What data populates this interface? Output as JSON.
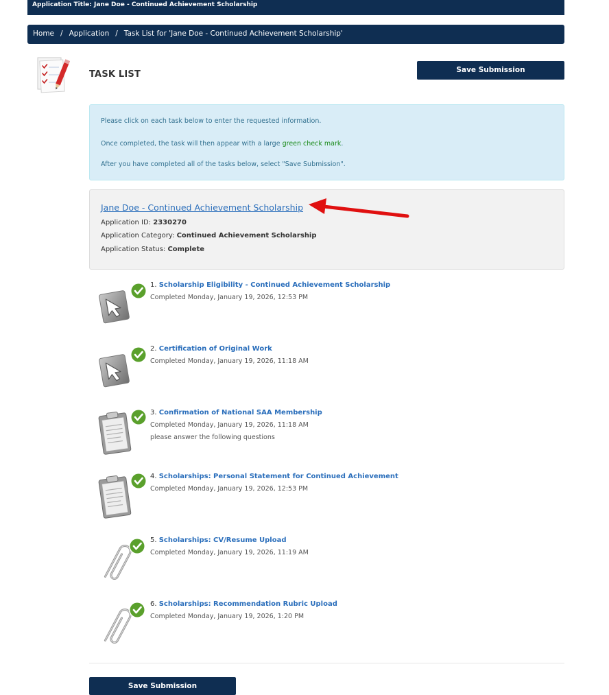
{
  "app_title_bar": "Application Title: Jane Doe - Continued Achievement Scholarship",
  "breadcrumb": {
    "items": [
      "Home",
      "Application",
      "Task List for 'Jane Doe - Continued Achievement Scholarship'"
    ],
    "separator": "/"
  },
  "page_title": "TASK LIST",
  "save_button_label": "Save Submission",
  "instructions": {
    "line1": "Please click on each task below to enter the requested information.",
    "line2_prefix": "Once completed, the task will then appear with a large ",
    "line2_highlight": "green check mark",
    "line2_suffix": ".",
    "line3": "After you have completed all of the tasks below, select \"Save Submission\"."
  },
  "application": {
    "title": "Jane Doe - Continued Achievement Scholarship",
    "id_label": "Application ID: ",
    "id_value": "2330270",
    "category_label": "Application Category: ",
    "category_value": "Continued Achievement Scholarship",
    "status_label": "Application Status: ",
    "status_value": "Complete"
  },
  "tasks": [
    {
      "number": "1.",
      "title": "Scholarship Eligibility - Continued Achievement Scholarship",
      "status": "Completed Monday, January 19, 2026, 12:53 PM",
      "note": "",
      "icon": "cursor-icon"
    },
    {
      "number": "2.",
      "title": "Certification of Original Work",
      "status": "Completed Monday, January 19, 2026, 11:18 AM",
      "note": "",
      "icon": "cursor-icon"
    },
    {
      "number": "3.",
      "title": "Confirmation of National SAA Membership",
      "status": "Completed Monday, January 19, 2026, 11:18 AM",
      "note": "please answer the following questions",
      "icon": "clipboard-icon"
    },
    {
      "number": "4.",
      "title": "Scholarships: Personal Statement for Continued Achievement",
      "status": "Completed Monday, January 19, 2026, 12:53 PM",
      "note": "",
      "icon": "clipboard-icon"
    },
    {
      "number": "5.",
      "title": "Scholarships: CV/Resume Upload",
      "status": "Completed Monday, January 19, 2026, 11:19 AM",
      "note": "",
      "icon": "paperclip-icon"
    },
    {
      "number": "6.",
      "title": "Scholarships: Recommendation Rubric Upload",
      "status": "Completed Monday, January 19, 2026, 1:20 PM",
      "note": "",
      "icon": "paperclip-icon"
    }
  ],
  "colors": {
    "navy": "#0f2e52",
    "info_bg": "#d9edf7",
    "info_text": "#31708f",
    "link": "#2a6ebb",
    "check_green": "#5aa02c",
    "arrow_red": "#e01010"
  }
}
